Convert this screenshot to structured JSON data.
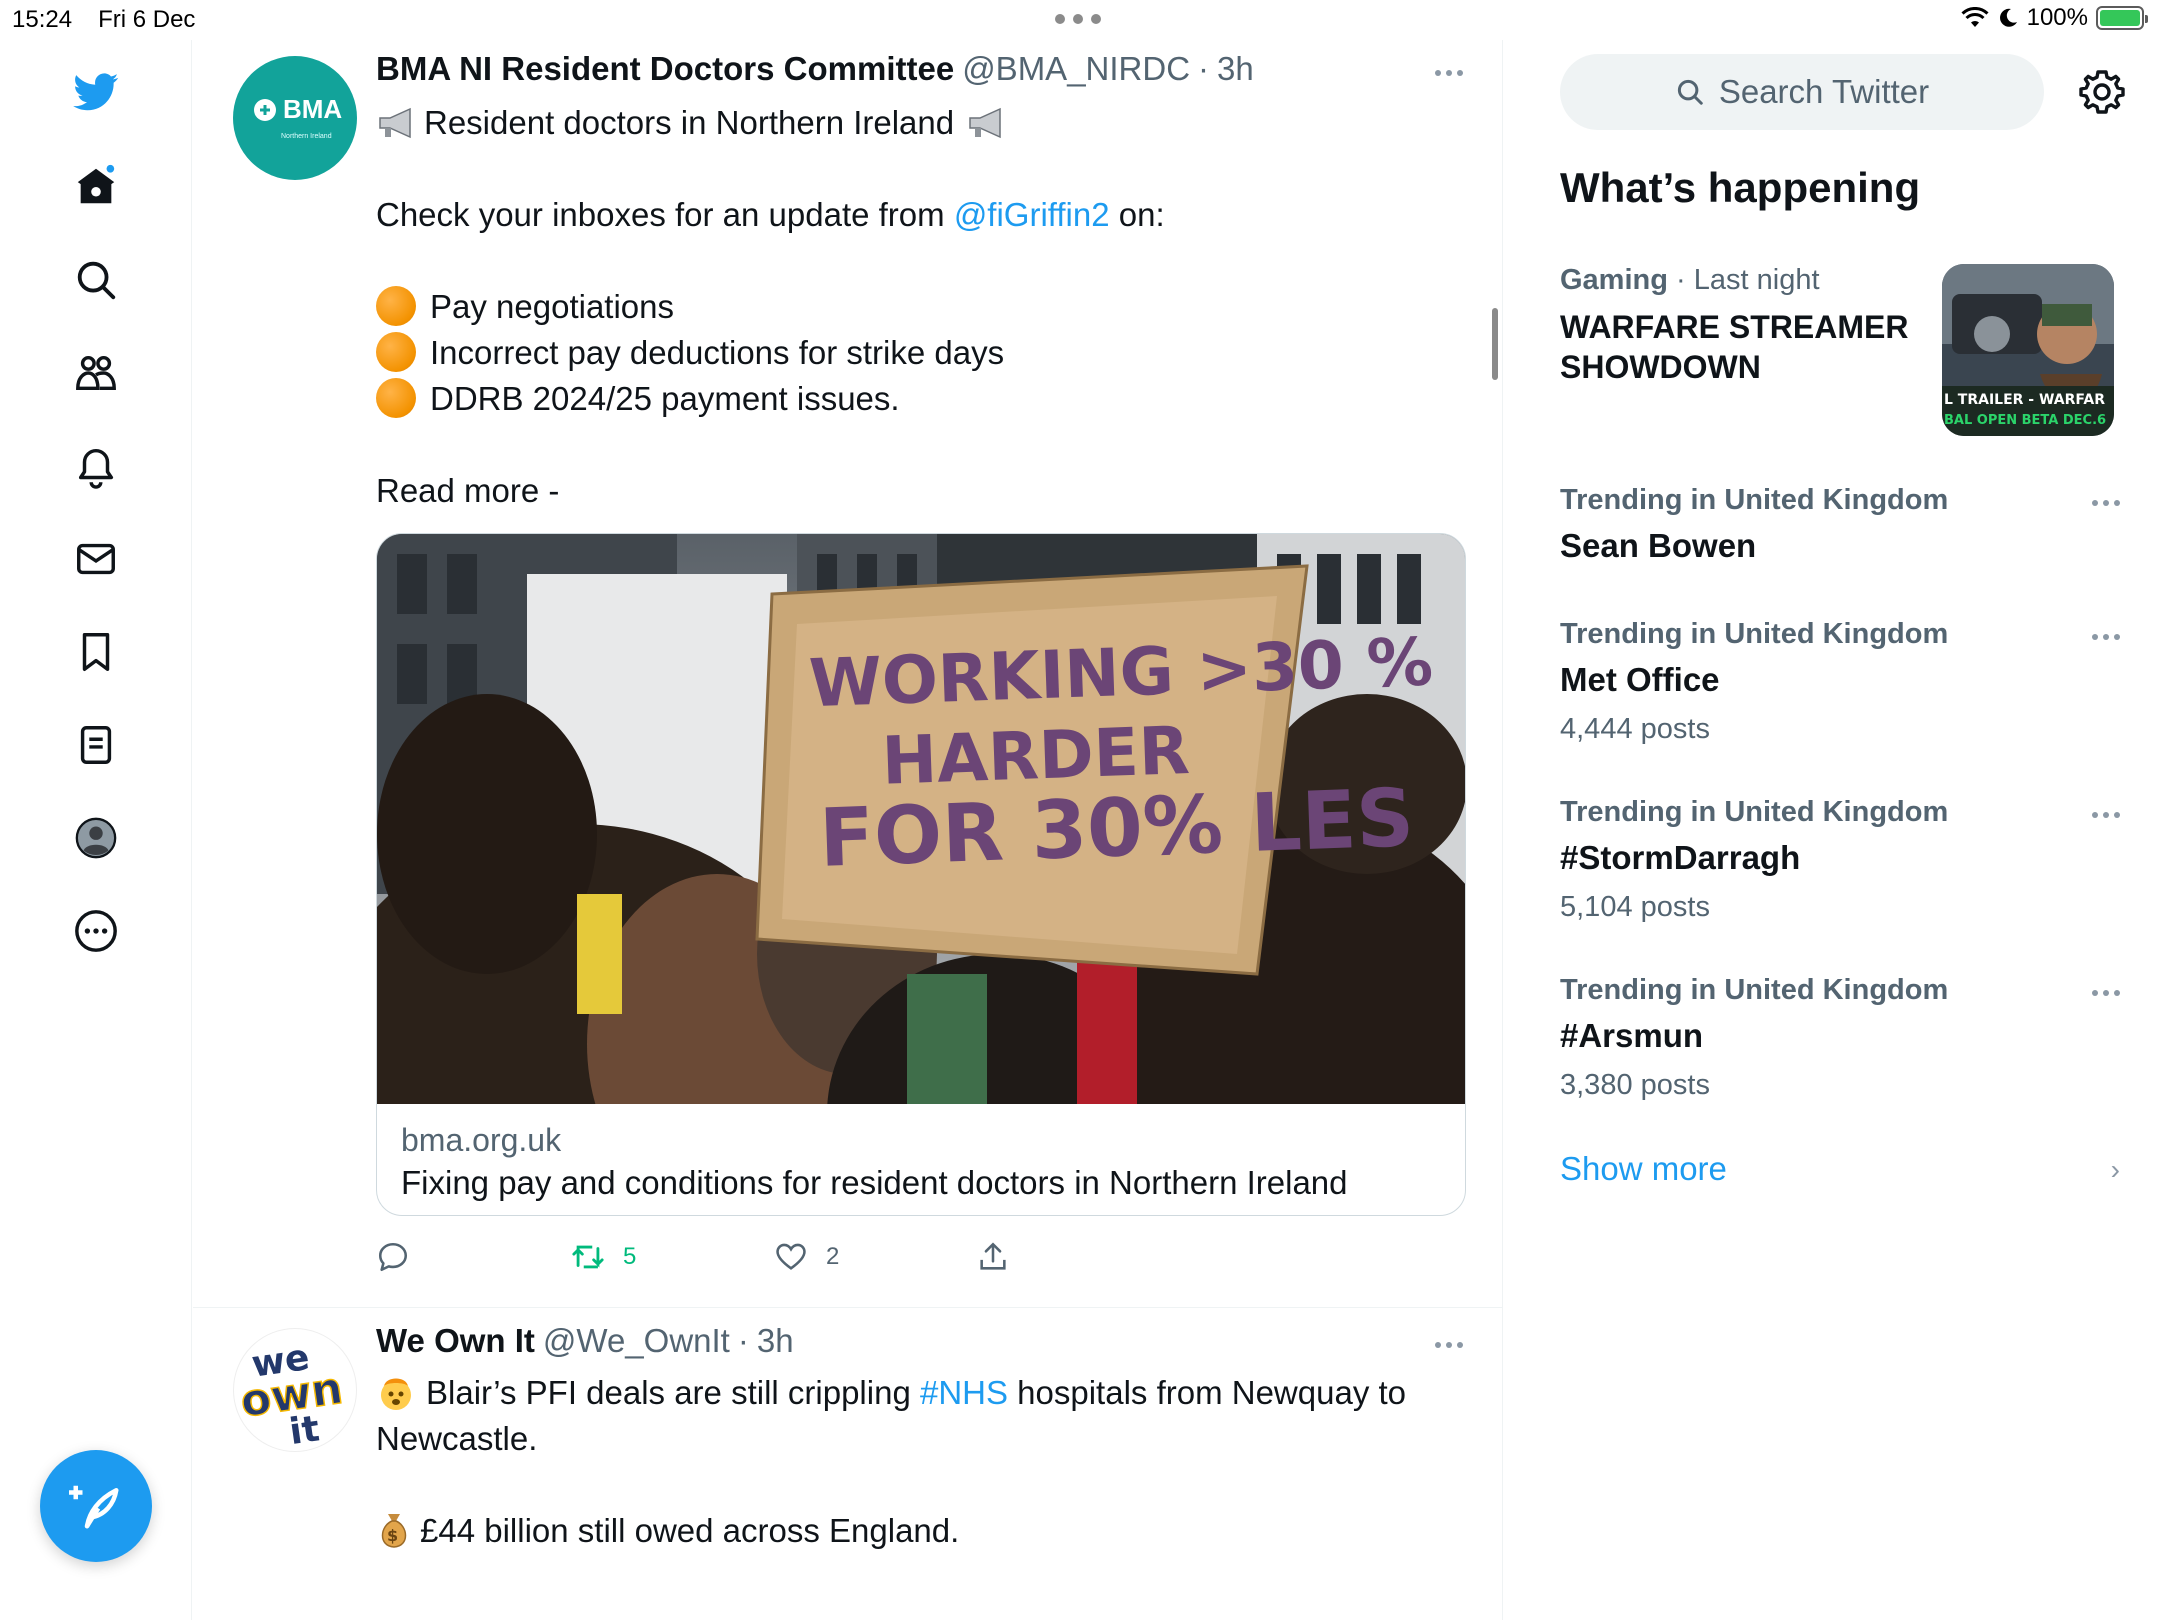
{
  "status_bar": {
    "time": "15:24",
    "date": "Fri 6 Dec",
    "battery": "100%"
  },
  "nav": {
    "items": [
      "twitter-logo",
      "home",
      "explore",
      "communities",
      "notifications",
      "messages",
      "bookmarks",
      "lists",
      "profile",
      "more"
    ],
    "accent": "#1d9bf0"
  },
  "tweets": [
    {
      "name": "BMA NI Resident Doctors Committee",
      "handle": "@BMA_NIRDC",
      "sep": "·",
      "time": "3h",
      "avatar_text": "BMA",
      "avatar_subtext": "Northern Ireland",
      "line1": "Resident doctors in Northern Ireland",
      "line2_pre": "Check your inboxes for an update from ",
      "line2_mention": "@fiGriffin2",
      "line2_post": " on:",
      "bullets": [
        "Pay negotiations",
        "Incorrect pay deductions for strike days",
        "DDRB 2024/25 payment issues."
      ],
      "read_more": "Read more -",
      "card": {
        "sign_lines": [
          "WORKING >30 %",
          "HARDER",
          "FOR 30% LES"
        ],
        "domain": "bma.org.uk",
        "title": "Fixing pay and conditions for resident doctors in Northern Ireland"
      },
      "actions": {
        "retweets": "5",
        "likes": "2"
      }
    },
    {
      "name": "We Own It",
      "handle": "@We_OwnIt",
      "sep": "·",
      "time": "3h",
      "avatar_lines": [
        "we",
        "own",
        "it"
      ],
      "line1_pre": "Blair’s PFI deals are still crippling ",
      "line1_hashtag": "#NHS",
      "line1_post": " hospitals from Newquay to",
      "line2": "Newcastle.",
      "line3": "£44 billion still owed across England."
    }
  ],
  "sidebar": {
    "search_placeholder": "Search Twitter",
    "section_title": "What’s happening",
    "featured": {
      "category": "Gaming",
      "sep": " · ",
      "when": "Last night",
      "title": "WARFARE STREAMER SHOWDOWN",
      "thumb_line1": "L TRAILER - WARFAR",
      "thumb_line2": "BAL OPEN BETA DEC.6"
    },
    "trends": [
      {
        "location": "Trending in United Kingdom",
        "topic": "Sean Bowen",
        "count": ""
      },
      {
        "location": "Trending in United Kingdom",
        "topic": "Met Office",
        "count": "4,444 posts"
      },
      {
        "location": "Trending in United Kingdom",
        "topic": "#StormDarragh",
        "count": "5,104 posts"
      },
      {
        "location": "Trending in United Kingdom",
        "topic": "#Arsmun",
        "count": "3,380 posts"
      }
    ],
    "show_more": "Show more"
  }
}
